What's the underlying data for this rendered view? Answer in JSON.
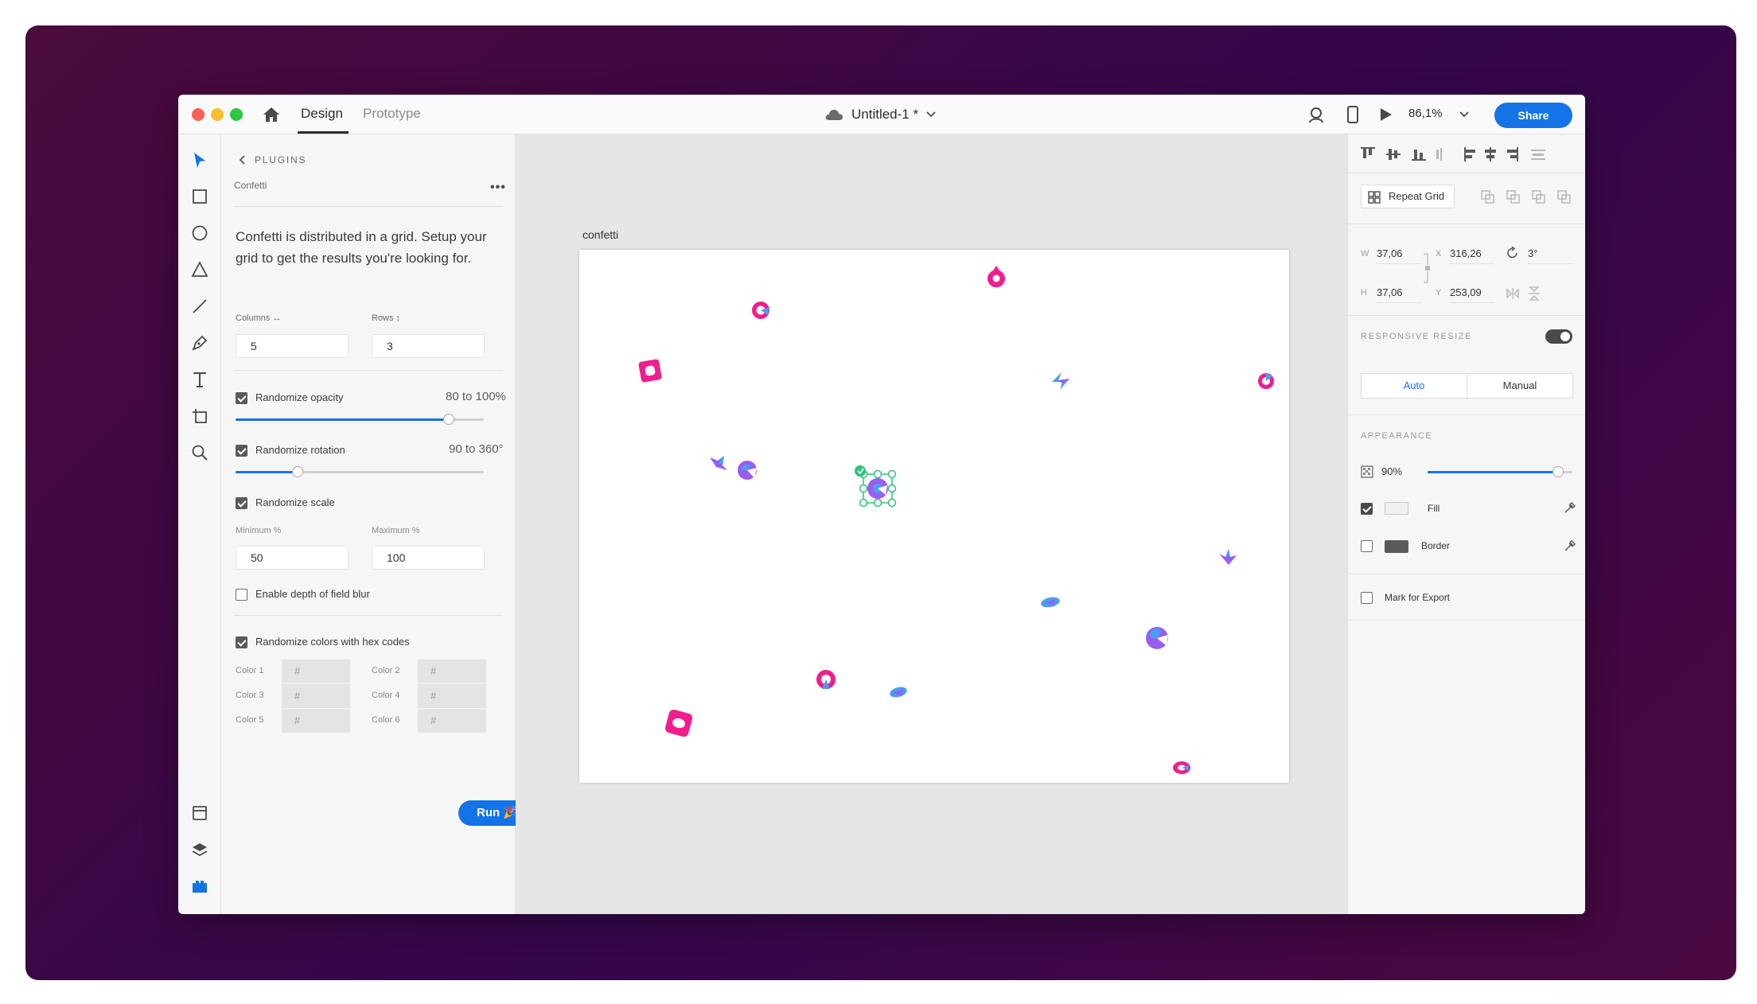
{
  "window": {
    "tabs": [
      {
        "label": "Design",
        "active": true
      },
      {
        "label": "Prototype",
        "active": false
      }
    ],
    "document_title": "Untitled-1 *",
    "zoom": "86,1%",
    "share_label": "Share"
  },
  "toolbar": {
    "tools": [
      "select-tool",
      "rectangle-tool",
      "ellipse-tool",
      "polygon-tool",
      "line-tool",
      "pen-tool",
      "text-tool",
      "artboard-tool",
      "zoom-tool"
    ],
    "bottom": [
      "assets-panel",
      "layers-panel",
      "plugins-panel"
    ]
  },
  "plugin": {
    "back_label": "PLUGINS",
    "name": "Confetti",
    "description": "Confetti is distributed in a grid. Setup your grid to get the results you're looking for.",
    "columns_label": "Columns ↔",
    "rows_label": "Rows ↕",
    "columns_value": "5",
    "rows_value": "3",
    "opacity": {
      "label": "Randomize opacity",
      "checked": true,
      "range": "80 to 100%",
      "level": 0.86
    },
    "rotation": {
      "label": "Randomize rotation",
      "checked": true,
      "range": "90 to 360°",
      "level": 0.25
    },
    "scale": {
      "label": "Randomize scale",
      "checked": true
    },
    "min_label": "Minimum %",
    "max_label": "Maximum %",
    "min_value": "50",
    "max_value": "100",
    "blur": {
      "label": "Enable depth of field blur",
      "checked": false
    },
    "colors": {
      "label": "Randomize colors with hex codes",
      "checked": true
    },
    "color_labels": [
      "Color 1",
      "Color 2",
      "Color 3",
      "Color 4",
      "Color 5",
      "Color 6"
    ],
    "hex_placeholder": "#",
    "run_label": "Run 🎉"
  },
  "canvas": {
    "artboard_name": "confetti",
    "colors": {
      "pink": "#f01e8c",
      "magenta": "#e8338f",
      "blue": "#4a9df0",
      "violet": "#9b5cf0"
    }
  },
  "properties": {
    "repeat_grid_label": "Repeat Grid",
    "w_label": "W",
    "w_value": "37,06",
    "h_label": "H",
    "h_value": "37,06",
    "x_label": "X",
    "x_value": "316,26",
    "y_label": "Y",
    "y_value": "253,09",
    "rotation_value": "3°",
    "responsive_label": "RESPONSIVE RESIZE",
    "responsive_on": true,
    "auto_label": "Auto",
    "manual_label": "Manual",
    "appearance_label": "APPEARANCE",
    "opacity_value": "90%",
    "opacity_level": 0.9,
    "fill_label": "Fill",
    "fill_checked": true,
    "border_label": "Border",
    "border_checked": false,
    "export_label": "Mark for Export",
    "export_checked": false
  }
}
